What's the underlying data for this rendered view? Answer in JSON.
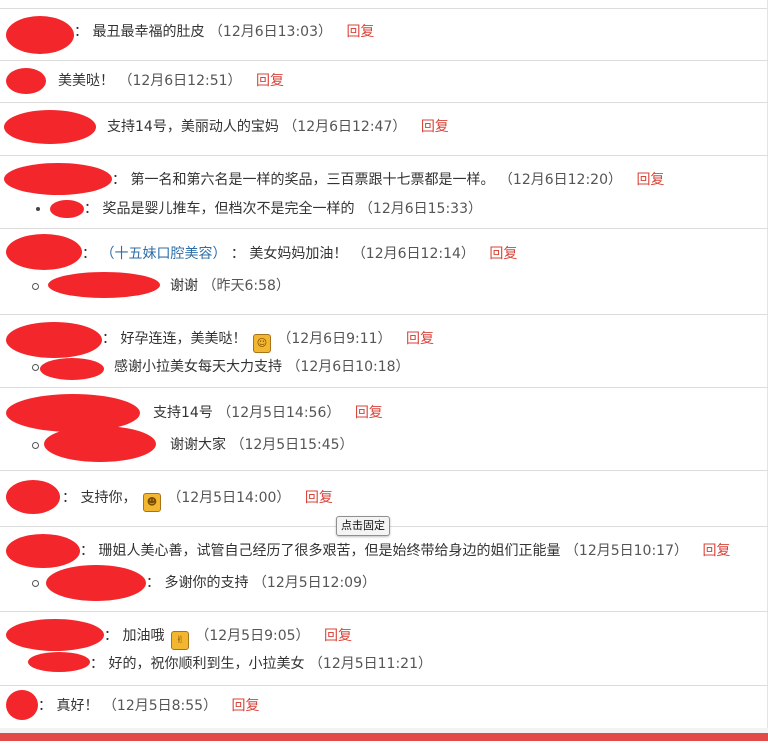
{
  "comments": [
    {
      "text": "最丑最幸福的肚皮",
      "time": "（12月6日13:03）",
      "reply": "回复"
    },
    {
      "text": "美美哒！",
      "time": "（12月6日12:51）",
      "reply": "回复"
    },
    {
      "text": "支持14号，美丽动人的宝妈",
      "time": "（12月6日12:47）",
      "reply": "回复"
    },
    {
      "text": "第一名和第六名是一样的奖品，三百票跟十七票都是一样。",
      "time": "（12月6日12:20）",
      "reply": "回复",
      "subreply": {
        "text": "奖品是婴儿推车，但档次不是完全一样的",
        "time": "（12月6日15:33）"
      }
    },
    {
      "tag": "（十五妹口腔美容）",
      "text": "美女妈妈加油！",
      "time": "（12月6日12:14）",
      "reply": "回复",
      "subreply": {
        "text": "谢谢",
        "time": "（昨天6:58）"
      }
    },
    {
      "text": "好孕连连，美美哒！",
      "time": "（12月6日9:11）",
      "reply": "回复",
      "emoji": "smile-emoji",
      "subreply": {
        "text": "感谢小拉美女每天大力支持",
        "time": "（12月6日10:18）"
      }
    },
    {
      "text": "支持14号",
      "time": "（12月5日14:56）",
      "reply": "回复",
      "subreply": {
        "text": "谢谢大家",
        "time": "（12月5日15:45）"
      }
    },
    {
      "text": "支持你，",
      "time": "（12月5日14:00）",
      "reply": "回复",
      "emoji": "grin-emoji"
    },
    {
      "text": "珊姐人美心善，试管自己经历了很多艰苦，但是始终带给身边的姐们正能量",
      "time": "（12月5日10:17）",
      "reply": "回复",
      "subreply": {
        "text": "多谢你的支持",
        "time": "（12月5日12:09）"
      }
    },
    {
      "text": "加油哦",
      "time": "（12月5日9:05）",
      "reply": "回复",
      "emoji": "cheer-emoji",
      "subreply": {
        "text": "好的，祝你顺利到生，小拉美女",
        "time": "（12月5日11:21）"
      }
    },
    {
      "text": "真好！",
      "time": "（12月5日8:55）",
      "reply": "回复"
    }
  ],
  "tooltip": "点击固定",
  "colors": {
    "reply": "#d9453a",
    "tag": "#2e6fa8",
    "redaction": "#f2262b",
    "bottom_bar": "#e24a4a"
  }
}
